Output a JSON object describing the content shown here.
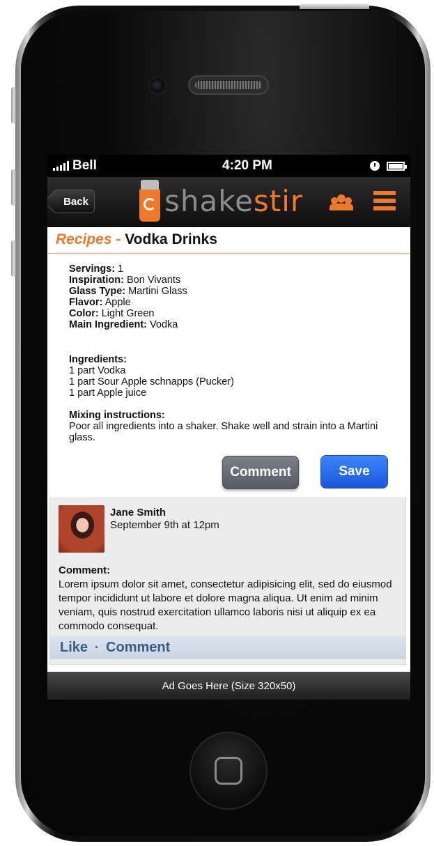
{
  "status_bar": {
    "carrier": "Bell",
    "time": "4:20 PM"
  },
  "nav": {
    "back_label": "Back",
    "logo_shake": "shake",
    "logo_stir": "stir"
  },
  "page_title": {
    "section": "Recipes",
    "separator": "-",
    "name": "Vodka Drinks"
  },
  "recipe": {
    "fields": [
      {
        "label": "Servings:",
        "value": "1"
      },
      {
        "label": "Inspiration:",
        "value": "Bon Vivants"
      },
      {
        "label": "Glass Type:",
        "value": "Martini Glass"
      },
      {
        "label": "Flavor:",
        "value": "Apple"
      },
      {
        "label": "Color:",
        "value": "Light Green"
      },
      {
        "label": "Main Ingredient:",
        "value": "Vodka"
      }
    ],
    "ingredients_label": "Ingredients:",
    "ingredients": [
      "1 part Vodka",
      "1 part Sour Apple schnapps (Pucker)",
      "1 part Apple juice"
    ],
    "mixing_label": "Mixing instructions:",
    "mixing_text": "Poor all ingredients into a shaker. Shake well and strain into a Martini glass."
  },
  "actions": {
    "comment_label": "Comment",
    "save_label": "Save"
  },
  "comment": {
    "author": "Jane Smith",
    "timestamp": "September 9th at 12pm",
    "label": "Comment:",
    "text": "Lorem ipsum dolor sit amet, consectetur adipisicing elit, sed do eiusmod tempor incididunt ut labore et dolore magna aliqua. Ut enim ad minim veniam, quis nostrud exercitation ullamco laboris nisi ut aliquip ex ea commodo consequat.",
    "like_label": "Like",
    "separator": "·",
    "comment_link_label": "Comment"
  },
  "ad": {
    "text": "Ad Goes Here (Size 320x50)"
  },
  "icons": {
    "users": "users-icon",
    "menu": "menu-icon",
    "clock": "clock-icon",
    "battery": "battery-icon",
    "signal": "signal-icon"
  },
  "colors": {
    "accent": "#f0782a",
    "save_button": "#2a6ef0",
    "link": "#3b5a8a"
  }
}
